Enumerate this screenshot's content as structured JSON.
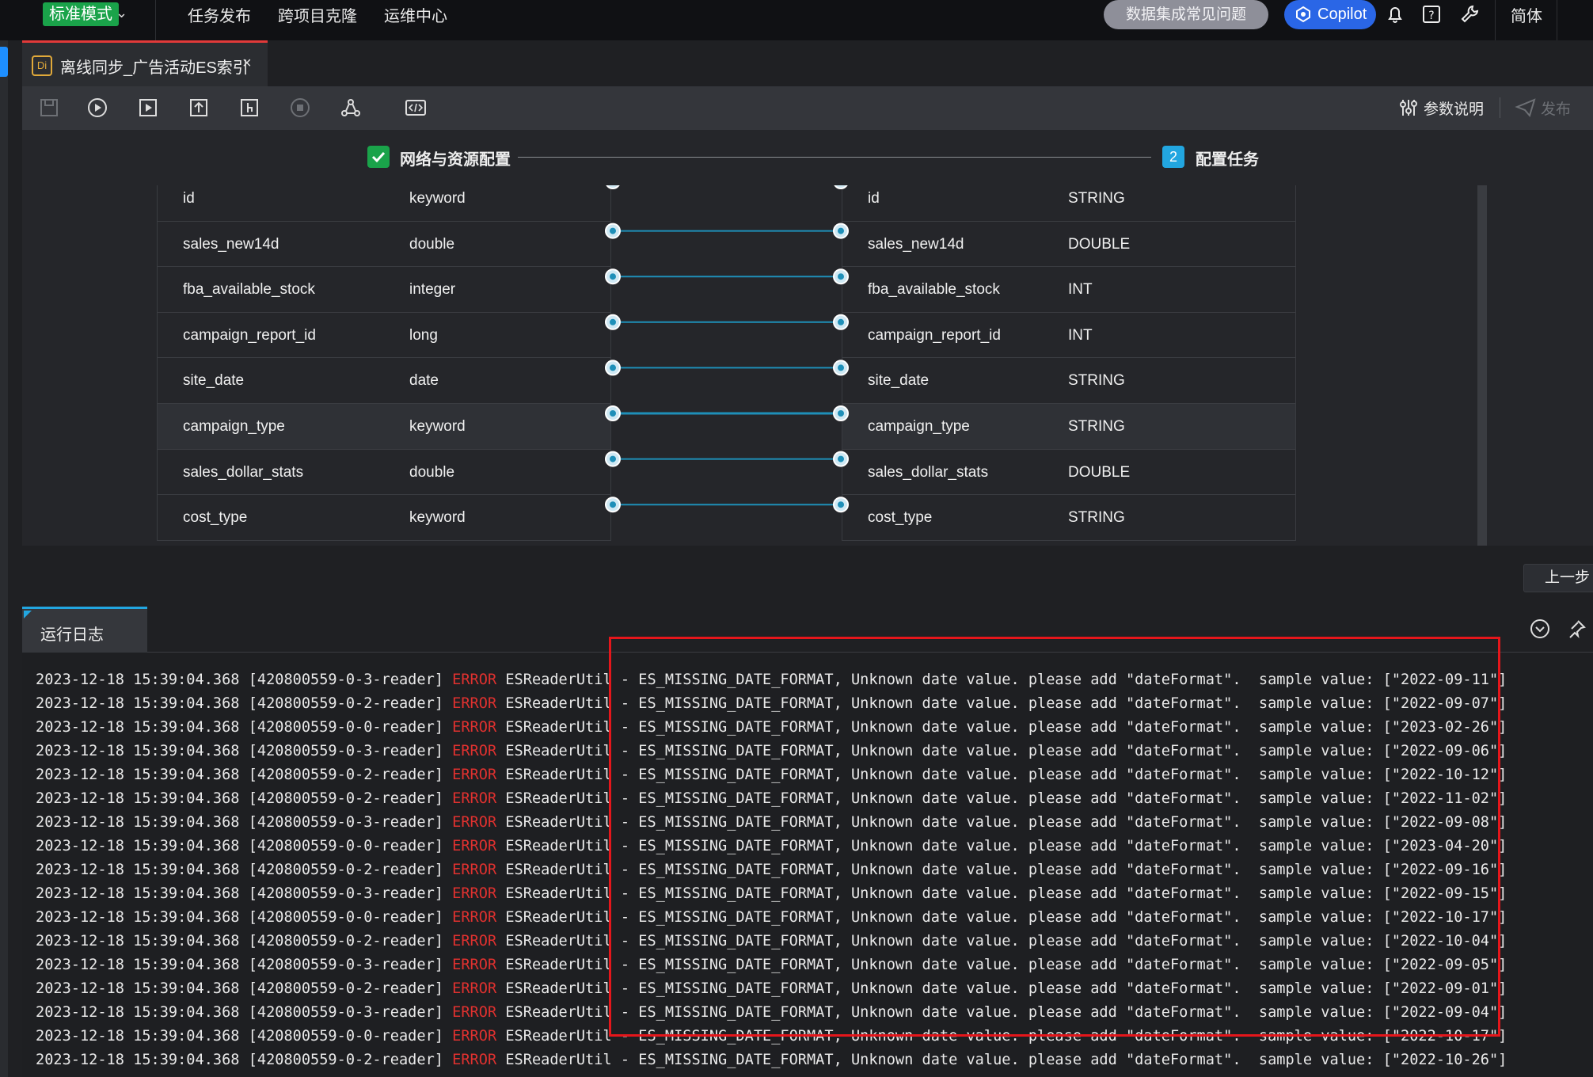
{
  "topbar": {
    "mode_label": "标准模式",
    "nav": [
      "任务发布",
      "跨项目克隆",
      "运维中心"
    ],
    "faq_label": "数据集成常见问题",
    "copilot_label": "Copilot",
    "lang_label": "简体"
  },
  "tab": {
    "badge": "Di",
    "title": "离线同步_广告活动ES索引",
    "close": "×"
  },
  "toolbar": {
    "params_label": "参数说明",
    "publish_label": "发布"
  },
  "steps": {
    "step1_label": "网络与资源配置",
    "step2_number": "2",
    "step2_label": "配置任务"
  },
  "mapping": {
    "rows": [
      {
        "src_name": "id",
        "src_type": "keyword",
        "dst_name": "id",
        "dst_type": "STRING"
      },
      {
        "src_name": "sales_new14d",
        "src_type": "double",
        "dst_name": "sales_new14d",
        "dst_type": "DOUBLE"
      },
      {
        "src_name": "fba_available_stock",
        "src_type": "integer",
        "dst_name": "fba_available_stock",
        "dst_type": "INT"
      },
      {
        "src_name": "campaign_report_id",
        "src_type": "long",
        "dst_name": "campaign_report_id",
        "dst_type": "INT"
      },
      {
        "src_name": "site_date",
        "src_type": "date",
        "dst_name": "site_date",
        "dst_type": "STRING"
      },
      {
        "src_name": "campaign_type",
        "src_type": "keyword",
        "dst_name": "campaign_type",
        "dst_type": "STRING"
      },
      {
        "src_name": "sales_dollar_stats",
        "src_type": "double",
        "dst_name": "sales_dollar_stats",
        "dst_type": "DOUBLE"
      },
      {
        "src_name": "cost_type",
        "src_type": "keyword",
        "dst_name": "cost_type",
        "dst_type": "STRING"
      }
    ]
  },
  "prev_button": "上一步",
  "log": {
    "tab_label": "运行日志",
    "timestamp": "2023-12-18 15:39:04.368",
    "level": "ERROR",
    "logger": "ESReaderUtil",
    "message": "ES_MISSING_DATE_FORMAT, Unknown date value. please add \"dateFormat\".  sample value:",
    "lines": [
      {
        "thread": "[420800559-0-3-reader]",
        "sample": "[\"2022-09-11\"]"
      },
      {
        "thread": "[420800559-0-2-reader]",
        "sample": "[\"2022-09-07\"]"
      },
      {
        "thread": "[420800559-0-0-reader]",
        "sample": "[\"2023-02-26\"]"
      },
      {
        "thread": "[420800559-0-3-reader]",
        "sample": "[\"2022-09-06\"]"
      },
      {
        "thread": "[420800559-0-2-reader]",
        "sample": "[\"2022-10-12\"]"
      },
      {
        "thread": "[420800559-0-2-reader]",
        "sample": "[\"2022-11-02\"]"
      },
      {
        "thread": "[420800559-0-3-reader]",
        "sample": "[\"2022-09-08\"]"
      },
      {
        "thread": "[420800559-0-0-reader]",
        "sample": "[\"2023-04-20\"]"
      },
      {
        "thread": "[420800559-0-2-reader]",
        "sample": "[\"2022-09-16\"]"
      },
      {
        "thread": "[420800559-0-3-reader]",
        "sample": "[\"2022-09-15\"]"
      },
      {
        "thread": "[420800559-0-0-reader]",
        "sample": "[\"2022-10-17\"]"
      },
      {
        "thread": "[420800559-0-2-reader]",
        "sample": "[\"2022-10-04\"]"
      },
      {
        "thread": "[420800559-0-3-reader]",
        "sample": "[\"2022-09-05\"]"
      },
      {
        "thread": "[420800559-0-2-reader]",
        "sample": "[\"2022-09-01\"]"
      },
      {
        "thread": "[420800559-0-3-reader]",
        "sample": "[\"2022-09-04\"]"
      },
      {
        "thread": "[420800559-0-0-reader]",
        "sample": "[\"2022-10-17\"]"
      },
      {
        "thread": "[420800559-0-2-reader]",
        "sample": "[\"2022-10-26\"]"
      }
    ]
  },
  "colors": {
    "accent": "#22a6e0",
    "error": "#e0312f",
    "annotation_box": "#e5161b",
    "mode_green": "#1aa34a"
  }
}
